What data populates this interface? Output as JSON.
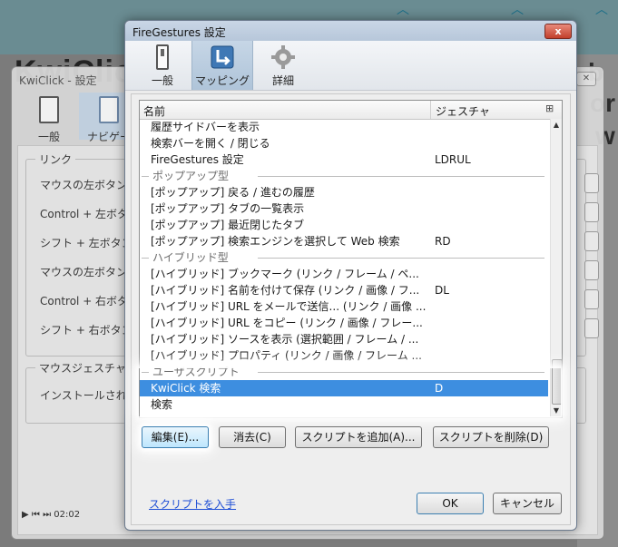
{
  "background": {
    "headline": "KwiClick",
    "right_letters": [
      "b",
      "or",
      "w"
    ],
    "media_time": "02:02"
  },
  "kwiclick_dialog": {
    "title": "KwiClick - 設定",
    "tabs": [
      {
        "label": "一般",
        "icon": "switch-icon"
      },
      {
        "label": "ナビゲー",
        "icon": "navigation-icon"
      }
    ],
    "link_group_title": "リンク",
    "rows": [
      "マウスの左ボタン",
      "Control + 左ボタ",
      "シフト + 左ボタン",
      "マウスの左ボタン",
      "Control + 右ボタ",
      "シフト + 右ボタン"
    ],
    "gesture_group_title": "マウスジェスチャ",
    "install_text": "インストールされ"
  },
  "firegestures_dialog": {
    "title": "FireGestures 設定",
    "close_label": "x",
    "tabs": [
      {
        "label": "一般",
        "icon": "switch-icon",
        "selected": false
      },
      {
        "label": "マッピング",
        "icon": "mapping-icon",
        "selected": true
      },
      {
        "label": "詳細",
        "icon": "gear-icon",
        "selected": false
      }
    ],
    "list": {
      "col_name": "名前",
      "col_gesture": "ジェスチャ",
      "rows": [
        {
          "name": "履歴サイドバーを表示",
          "gesture": "",
          "type": "item"
        },
        {
          "name": "検索バーを開く / 閉じる",
          "gesture": "",
          "type": "item"
        },
        {
          "name": "FireGestures 設定",
          "gesture": "LDRUL",
          "type": "item"
        },
        {
          "name": "ポップアップ型",
          "gesture": "",
          "type": "separator"
        },
        {
          "name": "[ポップアップ] 戻る / 進むの履歴",
          "gesture": "",
          "type": "item"
        },
        {
          "name": "[ポップアップ] タブの一覧表示",
          "gesture": "",
          "type": "item"
        },
        {
          "name": "[ポップアップ] 最近閉じたタブ",
          "gesture": "",
          "type": "item"
        },
        {
          "name": "[ポップアップ] 検索エンジンを選択して Web 検索",
          "gesture": "RD",
          "type": "item"
        },
        {
          "name": "ハイブリッド型",
          "gesture": "",
          "type": "separator"
        },
        {
          "name": "[ハイブリッド] ブックマーク (リンク / フレーム / ペ...",
          "gesture": "",
          "type": "item"
        },
        {
          "name": "[ハイブリッド] 名前を付けて保存 (リンク / 画像 / フ...",
          "gesture": "DL",
          "type": "item"
        },
        {
          "name": "[ハイブリッド] URL をメールで送信... (リンク / 画像 ...",
          "gesture": "",
          "type": "item"
        },
        {
          "name": "[ハイブリッド] URL をコピー (リンク / 画像 / フレー...",
          "gesture": "",
          "type": "item"
        },
        {
          "name": "[ハイブリッド] ソースを表示 (選択範囲 / フレーム / ...",
          "gesture": "",
          "type": "item"
        },
        {
          "name": "[ハイブリッド] プロパティ (リンク / 画像 / フレーム ...",
          "gesture": "",
          "type": "item"
        },
        {
          "name": "ユーザスクリプト",
          "gesture": "",
          "type": "separator"
        },
        {
          "name": "KwiClick 検索",
          "gesture": "D",
          "type": "selected"
        },
        {
          "name": "検索",
          "gesture": "",
          "type": "item"
        }
      ]
    },
    "buttons": {
      "edit": "編集(E)...",
      "clear": "消去(C)",
      "add_script": "スクリプトを追加(A)...",
      "delete_script": "スクリプトを削除(D)",
      "ok": "OK",
      "cancel": "キャンセル"
    },
    "get_scripts_link": "スクリプトを入手"
  },
  "colors": {
    "selection": "#3d8ee0",
    "link": "#1f4fd6",
    "close_button": "#c2402c"
  }
}
